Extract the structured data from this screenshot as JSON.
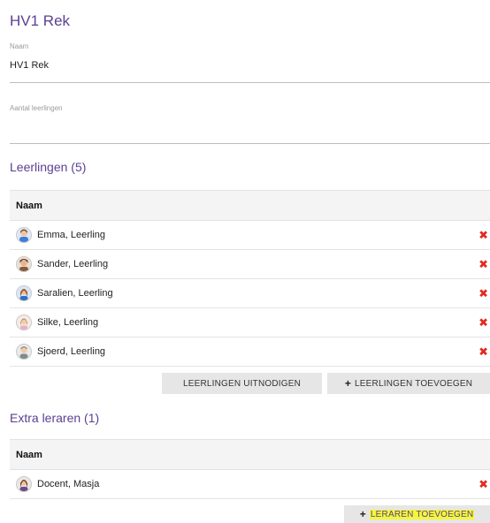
{
  "class": {
    "title": "HV1 Rek",
    "name_label": "Naam",
    "name_value": "HV1 Rek",
    "count_label": "Aantal leerlingen",
    "count_value": ""
  },
  "students": {
    "title": "Leerlingen (5)",
    "column_header": "Naam",
    "rows": [
      {
        "name": "Emma, Leerling",
        "avatar": "student-avatar-icon"
      },
      {
        "name": "Sander, Leerling",
        "avatar": "student-avatar-icon"
      },
      {
        "name": "Saralien, Leerling",
        "avatar": "student-avatar-icon"
      },
      {
        "name": "Silke, Leerling",
        "avatar": "student-avatar-icon"
      },
      {
        "name": "Sjoerd, Leerling",
        "avatar": "student-avatar-icon"
      }
    ],
    "invite_button": "LEERLINGEN UITNODIGEN",
    "add_button": "LEERLINGEN TOEVOEGEN",
    "add_icon": "+"
  },
  "teachers": {
    "title": "Extra leraren (1)",
    "column_header": "Naam",
    "rows": [
      {
        "name": "Docent, Masja",
        "avatar": "teacher-avatar-icon"
      }
    ],
    "add_button": "LERAREN TOEVOEGEN",
    "add_icon": "+"
  },
  "remove_icon": "✖",
  "colors": {
    "accent": "#5b3f93",
    "remove": "#e02b1f",
    "button_bg": "#e6e6e6",
    "highlight": "#f3f73a"
  }
}
